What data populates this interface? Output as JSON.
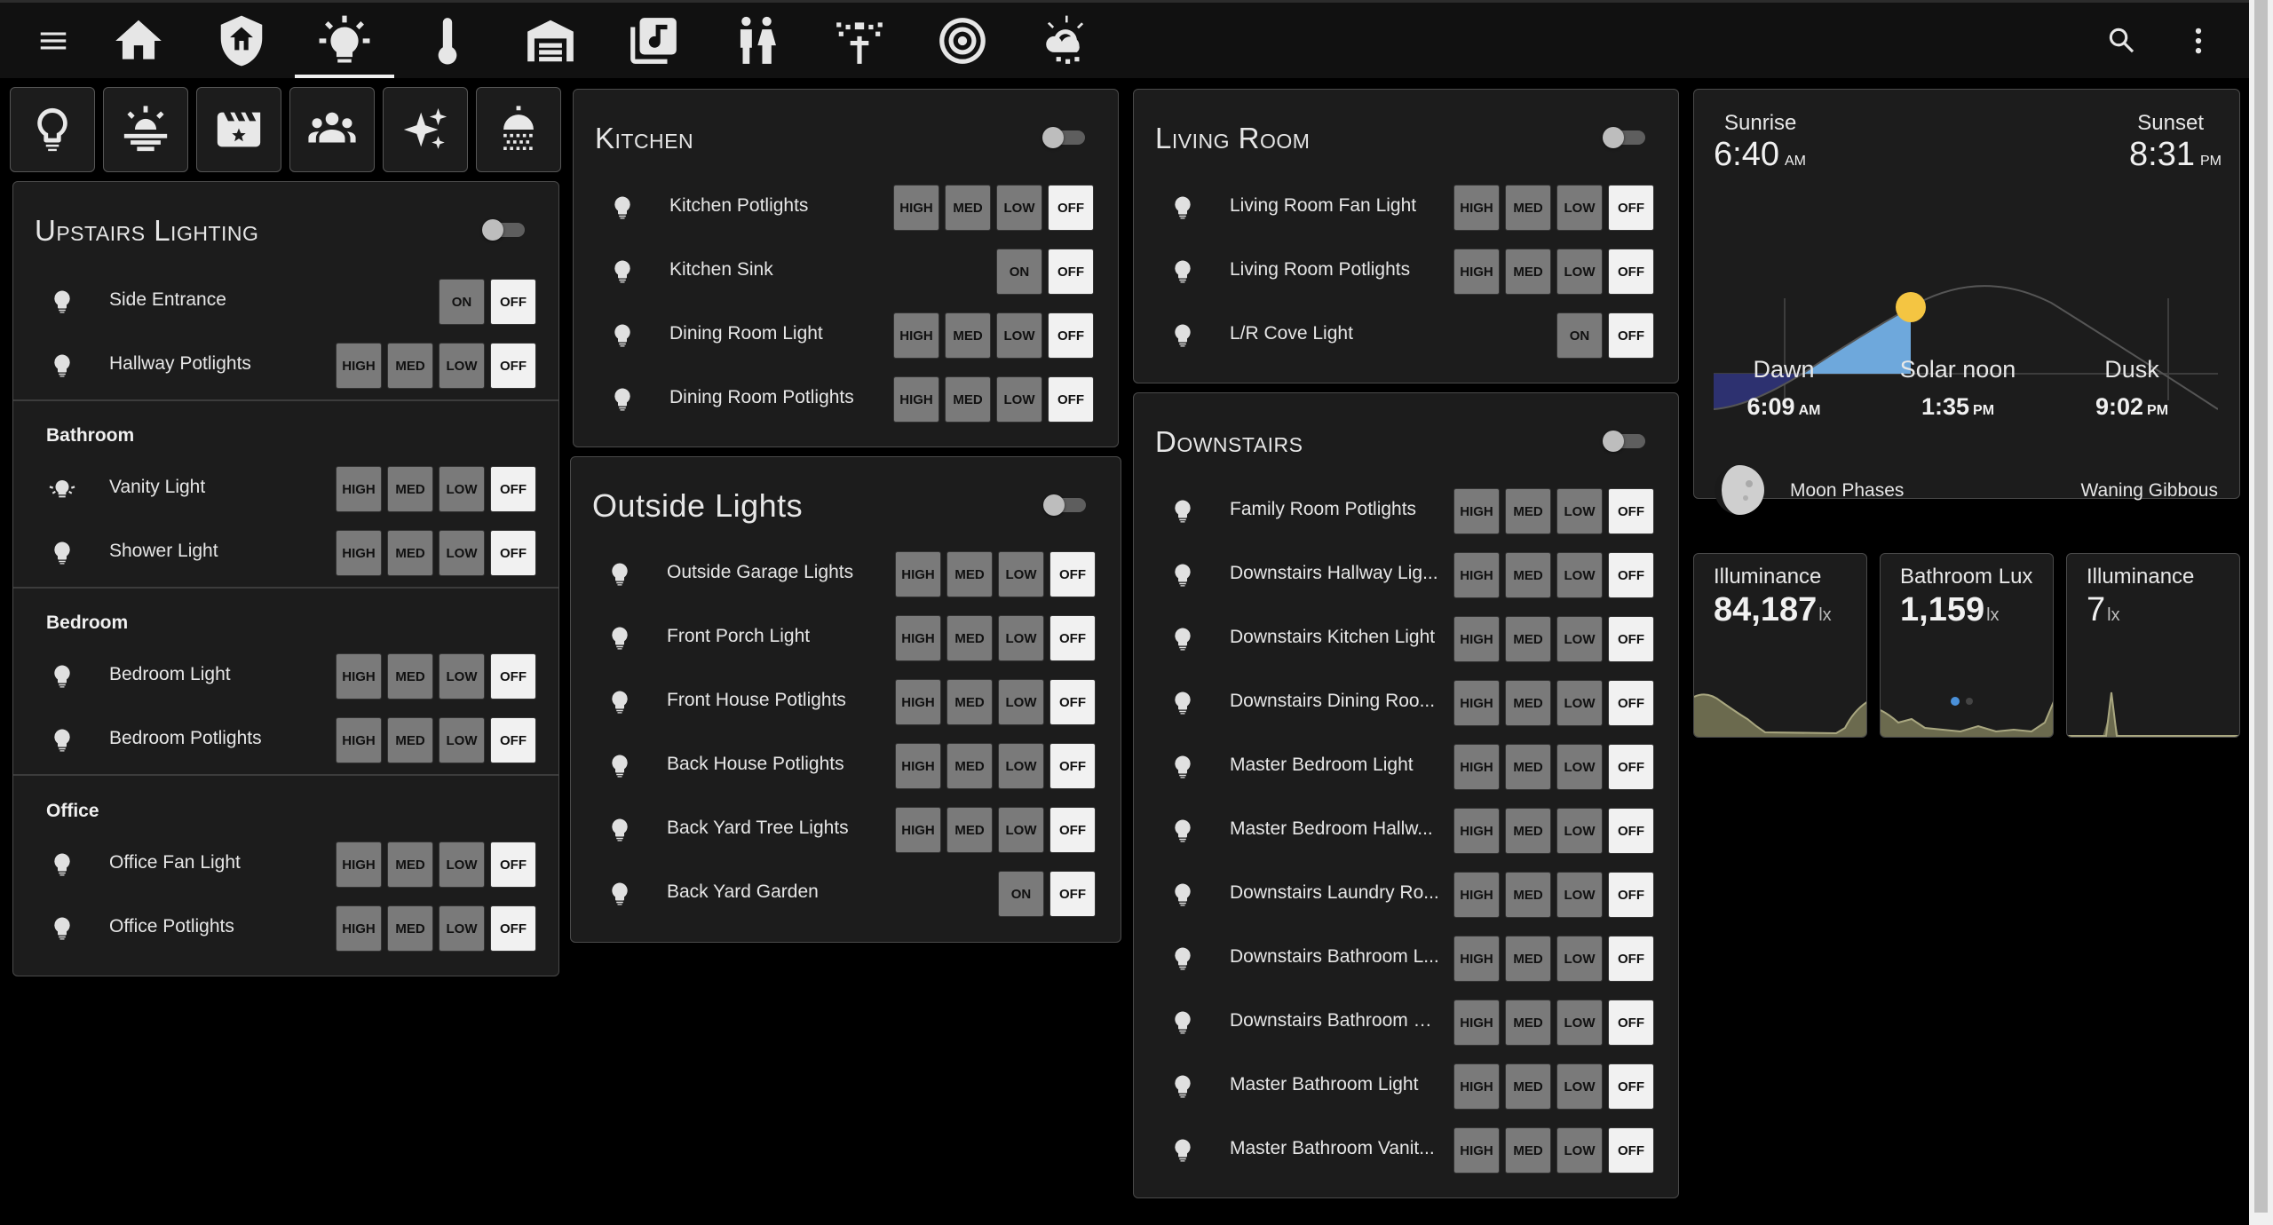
{
  "header": {
    "tabs": [
      "home-icon",
      "shield-home-icon",
      "lightbulb-on-icon",
      "thermometer-icon",
      "garage-icon",
      "music-box-icon",
      "human-male-female-icon",
      "sprinkler-icon",
      "smoke-detector-icon",
      "weather-snowy-icon"
    ],
    "active_tab": "lightbulb-on-icon"
  },
  "scenes": [
    "lightbulb-outline-icon",
    "weather-sunset-icon",
    "movie-star-icon",
    "account-group-icon",
    "sparkles-icon",
    "shower-icon"
  ],
  "button_labels": {
    "high": "HIGH",
    "med": "MED",
    "low": "LOW",
    "off": "OFF",
    "on": "ON"
  },
  "upstairs": {
    "title": "Upstairs Lighting",
    "rows": [
      {
        "name": "Side Entrance"
      },
      {
        "name": "Hallway Potlights"
      }
    ],
    "bathroom": {
      "label": "Bathroom",
      "rows": [
        {
          "name": "Vanity Light"
        },
        {
          "name": "Shower Light"
        }
      ]
    },
    "bedroom": {
      "label": "Bedroom",
      "rows": [
        {
          "name": "Bedroom Light"
        },
        {
          "name": "Bedroom Potlights"
        }
      ]
    },
    "office": {
      "label": "Office",
      "rows": [
        {
          "name": "Office Fan Light"
        },
        {
          "name": "Office Potlights"
        }
      ]
    }
  },
  "kitchen": {
    "title": "Kitchen",
    "rows": [
      {
        "name": "Kitchen Potlights"
      },
      {
        "name": "Kitchen Sink"
      },
      {
        "name": "Dining Room Light"
      },
      {
        "name": "Dining Room Potlights"
      }
    ]
  },
  "outside": {
    "title": "Outside Lights",
    "rows": [
      {
        "name": "Outside Garage Lights"
      },
      {
        "name": "Front Porch Light"
      },
      {
        "name": "Front House Potlights"
      },
      {
        "name": "Back House Potlights"
      },
      {
        "name": "Back Yard Tree Lights"
      },
      {
        "name": "Back Yard Garden"
      }
    ]
  },
  "living": {
    "title": "Living Room",
    "rows": [
      {
        "name": "Living Room Fan Light"
      },
      {
        "name": "Living Room Potlights"
      },
      {
        "name": "L/R Cove Light"
      }
    ]
  },
  "downstairs": {
    "title": "Downstairs",
    "rows": [
      {
        "name": "Family Room Potlights"
      },
      {
        "name": "Downstairs Hallway Lig..."
      },
      {
        "name": "Downstairs Kitchen Light"
      },
      {
        "name": "Downstairs Dining Roo..."
      },
      {
        "name": "Master Bedroom Light"
      },
      {
        "name": "Master Bedroom Hallw..."
      },
      {
        "name": "Downstairs Laundry Ro..."
      },
      {
        "name": "Downstairs Bathroom L..."
      },
      {
        "name": "Downstairs Bathroom V..."
      },
      {
        "name": "Master Bathroom Light"
      },
      {
        "name": "Master Bathroom Vanit..."
      }
    ]
  },
  "sun": {
    "sunrise_label": "Sunrise",
    "sunrise_time": "6:40",
    "sunrise_ampm": "AM",
    "sunset_label": "Sunset",
    "sunset_time": "8:31",
    "sunset_ampm": "PM",
    "dawn_label": "Dawn",
    "dawn_time": "6:09",
    "dawn_ampm": "AM",
    "noon_label": "Solar noon",
    "noon_time": "1:35",
    "noon_ampm": "PM",
    "dusk_label": "Dusk",
    "dusk_time": "9:02",
    "dusk_ampm": "PM",
    "moon_label": "Moon Phases",
    "moon_value": "Waning Gibbous"
  },
  "sensors": [
    {
      "name": "Illuminance",
      "value": "84,187",
      "unit": "lx"
    },
    {
      "name": "Bathroom Lux",
      "value": "1,159",
      "unit": "lx"
    },
    {
      "name": "Illuminance",
      "value": "7",
      "unit": "lx"
    }
  ],
  "colors": {
    "background": "#000000",
    "card": "#1c1c1c",
    "sun": "#f4c542",
    "daylight": "#6ea8dc",
    "night": "#2d3170",
    "sensor_fill": "#6b6a4e"
  }
}
